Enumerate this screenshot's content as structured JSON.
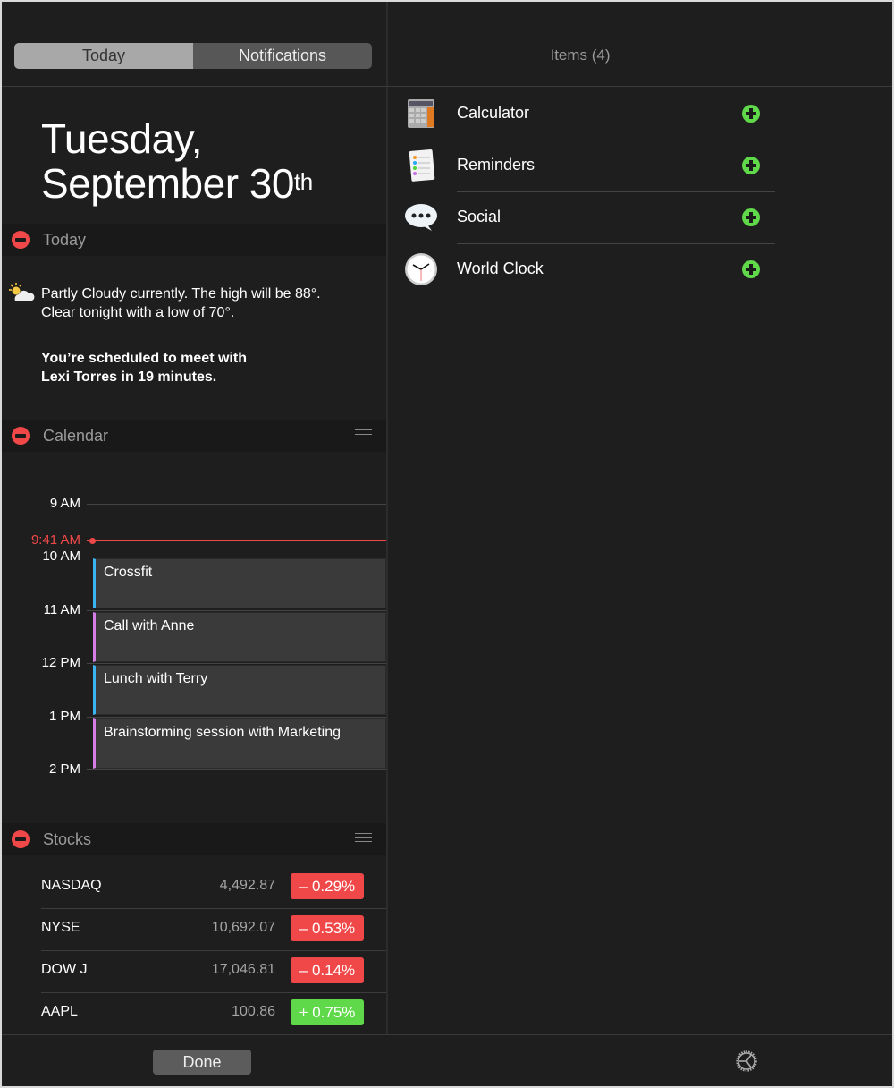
{
  "header": {
    "tabs": [
      {
        "label": "Today",
        "selected": true
      },
      {
        "label": "Notifications",
        "selected": false
      }
    ],
    "items_title": "Items (4)"
  },
  "date": {
    "line1": "Tuesday,",
    "line2": "September 30",
    "suffix": "th"
  },
  "today_section": {
    "title": "Today",
    "weather_line1": "Partly Cloudy currently. The high will be 88°.",
    "weather_line2": "Clear tonight with a low of 70°.",
    "meeting_line1": "You’re scheduled to meet with",
    "meeting_line2": "Lexi Torres in 19 minutes.",
    "weather_icon": "partly-cloudy-icon"
  },
  "calendar": {
    "title": "Calendar",
    "current_time": "9:41 AM",
    "hours": [
      "9 AM",
      "10 AM",
      "11 AM",
      "12 PM",
      "1 PM",
      "2 PM"
    ],
    "events": [
      {
        "title": "Crossfit",
        "color": "#3ab4f2"
      },
      {
        "title": "Call with Anne",
        "color": "#d67ee8"
      },
      {
        "title": "Lunch with Terry",
        "color": "#3ab4f2"
      },
      {
        "title": "Brainstorming session with Marketing",
        "color": "#d67ee8"
      }
    ]
  },
  "stocks": {
    "title": "Stocks",
    "rows": [
      {
        "name": "NASDAQ",
        "price": "4,492.87",
        "change": "– 0.29%",
        "color": "#f04848"
      },
      {
        "name": "NYSE",
        "price": "10,692.07",
        "change": "– 0.53%",
        "color": "#f04848"
      },
      {
        "name": "DOW J",
        "price": "17,046.81",
        "change": "– 0.14%",
        "color": "#f04848"
      },
      {
        "name": "AAPL",
        "price": "100.86",
        "change": "+ 0.75%",
        "color": "#5fd84a"
      }
    ]
  },
  "items": [
    {
      "label": "Calculator",
      "icon": "calculator-icon"
    },
    {
      "label": "Reminders",
      "icon": "reminders-icon"
    },
    {
      "label": "Social",
      "icon": "social-icon"
    },
    {
      "label": "World Clock",
      "icon": "world-clock-icon"
    }
  ],
  "footer": {
    "done_label": "Done",
    "settings_icon": "gear-icon"
  }
}
